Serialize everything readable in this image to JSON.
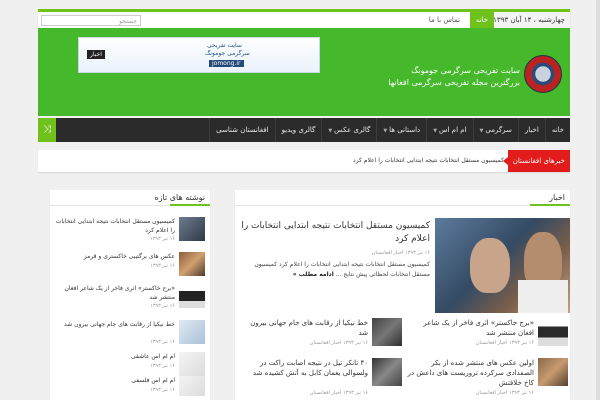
{
  "topbar": {
    "date": "چهارشنبه ، ۱۴ آبان ۱۳۹۳",
    "nav": [
      "خانه",
      "تماس با ما"
    ],
    "search_placeholder": "جستجو"
  },
  "header": {
    "site_title": "سایت تفریحی سرگرمی جومونگ",
    "site_subtitle": "بزرگترین مجله تفریحی سرگرمی افغانها",
    "banner": {
      "line1": "سایت تفریحی",
      "line2": "سرگرمی جومونگ",
      "domain": "jomong.ir",
      "tag": "اخبار"
    }
  },
  "mainnav": {
    "items": [
      "خانه",
      "اخبار",
      "سرگرمی",
      "ام ام اس",
      "داستانی ها",
      "گالری عکس",
      "گالری ویدیو",
      "افغانستان شناسی"
    ],
    "dropdown": [
      false,
      false,
      true,
      true,
      true,
      true,
      false,
      false
    ]
  },
  "breaking": {
    "label": "خبرهای افغانستان",
    "text": "کمیسیون مستقل انتخابات نتیجه ابتدایی انتخابات را اعلام کرد"
  },
  "main": {
    "section_title": "اخبار",
    "featured": {
      "title": "کمیسیون مستقل انتخابات نتیجه ابتدایی انتخابات را اعلام کرد",
      "meta": "۱۶ تیر ۱۳۹۳ اخبار افغانستان",
      "excerpt": "کمیسیون مستقل انتخابات نتیجه ابتدایی انتخابات را اعلام کرد کمیسیون مستقل انتخابات لحظاتی پیش نتایج ...",
      "more": "ادامه مطلب »"
    },
    "items": [
      {
        "title": "«برج خاکستر» اثری فاخر از یک شاعر افغان منتشر شد",
        "meta": "۱۶ تیر ۱۳۹۳ اخبار افغانستان"
      },
      {
        "title": "خط نیکیا از رقابت های جام جهانی بیرون شد",
        "meta": "۱۶ تیر ۱۳۹۳ اخبار افغانستان"
      },
      {
        "title": "اولین عکس های منتشر شده از بکر الصفدادی سرکرده تروریست های داعش در کاخ خلافتش",
        "meta": "۱۶ تیر ۱۳۹۳ اخبار افغانستان"
      },
      {
        "title": "۴۰ تانکر تیل در نتیجه اصابت راکت در ولسوالی یغمان کابل به آتش کشیده شد",
        "meta": "۱۶ تیر ۱۳۹۳ اخبار افغانستان"
      }
    ]
  },
  "sidebar": {
    "section_title": "نوشته های تازه",
    "items": [
      {
        "title": "کمیسیون مستقل انتخابات نتیجه ابتدایی انتخابات را اعلام کرد",
        "meta": "۱۶ تیر ۱۳۹۳"
      },
      {
        "title": "عکس های برگتیبی خاکستری و قرمز",
        "meta": "۱۶ تیر ۱۳۹۳"
      },
      {
        "title": "«برج خاکستر» اثری فاخر از یک شاعر افغان منتشر شد",
        "meta": "۱۶ تیر ۱۳۹۳"
      },
      {
        "title": "خط نیکیا از رقابت های جام جهانی بیرون شد",
        "meta": "۱۶ تیر ۱۳۹۳"
      },
      {
        "title": "ام ام اس عاشقی",
        "meta": "۱۶ تیر ۱۳۹۳"
      },
      {
        "title": "ام ام اس فلسفی",
        "meta": "۱۶ تیر ۱۳۹۳"
      }
    ]
  },
  "colors": {
    "accent": "#6fc21b",
    "header": "#45b82c",
    "nav": "#2b2b2b",
    "breaking": "#e21b1b"
  }
}
